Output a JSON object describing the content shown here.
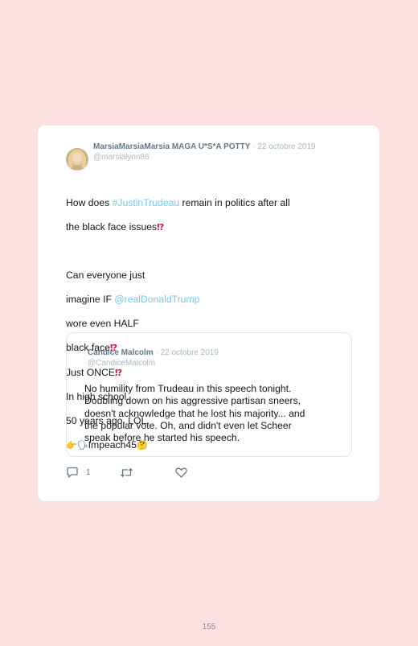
{
  "tweet": {
    "author": "MarsiaMarsiaMarsia MAGA U*S*A POTTY",
    "date": "22 octobre 2019",
    "handle": "@marsialynn86",
    "lines": [
      {
        "t1": "How does ",
        "link": "#JustinTrudeau",
        "t2": " remain in politics after all"
      },
      {
        "t": "the black face issues"
      },
      {
        "t": ""
      },
      {
        "t": "Can everyone just"
      },
      {
        "t1": "imagine IF ",
        "link": "@realDonaldTrump"
      },
      {
        "t": "wore even HALF"
      },
      {
        "t": "black face"
      },
      {
        "t": "Just ONCE"
      },
      {
        "t": "In high school."
      },
      {
        "t": "50 years ago. LOL"
      },
      {
        "t": "Impeach45"
      }
    ],
    "emojis": {
      "interrobang": "⁉",
      "pointing": "👉",
      "speaking_head": "🗣",
      "thinking": "🤔"
    }
  },
  "quoted": {
    "author": "Candice Malcolm",
    "date": "22 octobre 2019",
    "handle": "@CandiceMalcolm",
    "lines": [
      "No humility from Trudeau in this speech tonight.",
      "Doubling down on his aggressive partisan sneers,",
      "doesn't acknowledge that he lost his majority... and",
      "the popular vote. Oh, and didn't even let Scheer",
      "speak before he started his speech."
    ]
  },
  "actions": {
    "reply_count": "1",
    "reply_icon": "reply-icon",
    "retweet_icon": "retweet-icon",
    "like_icon": "heart-icon"
  },
  "page_number": "155",
  "colors": {
    "background": "#fde1e1",
    "link": "#7fc6ea",
    "meta": "#aab8c2",
    "author": "#657786"
  }
}
